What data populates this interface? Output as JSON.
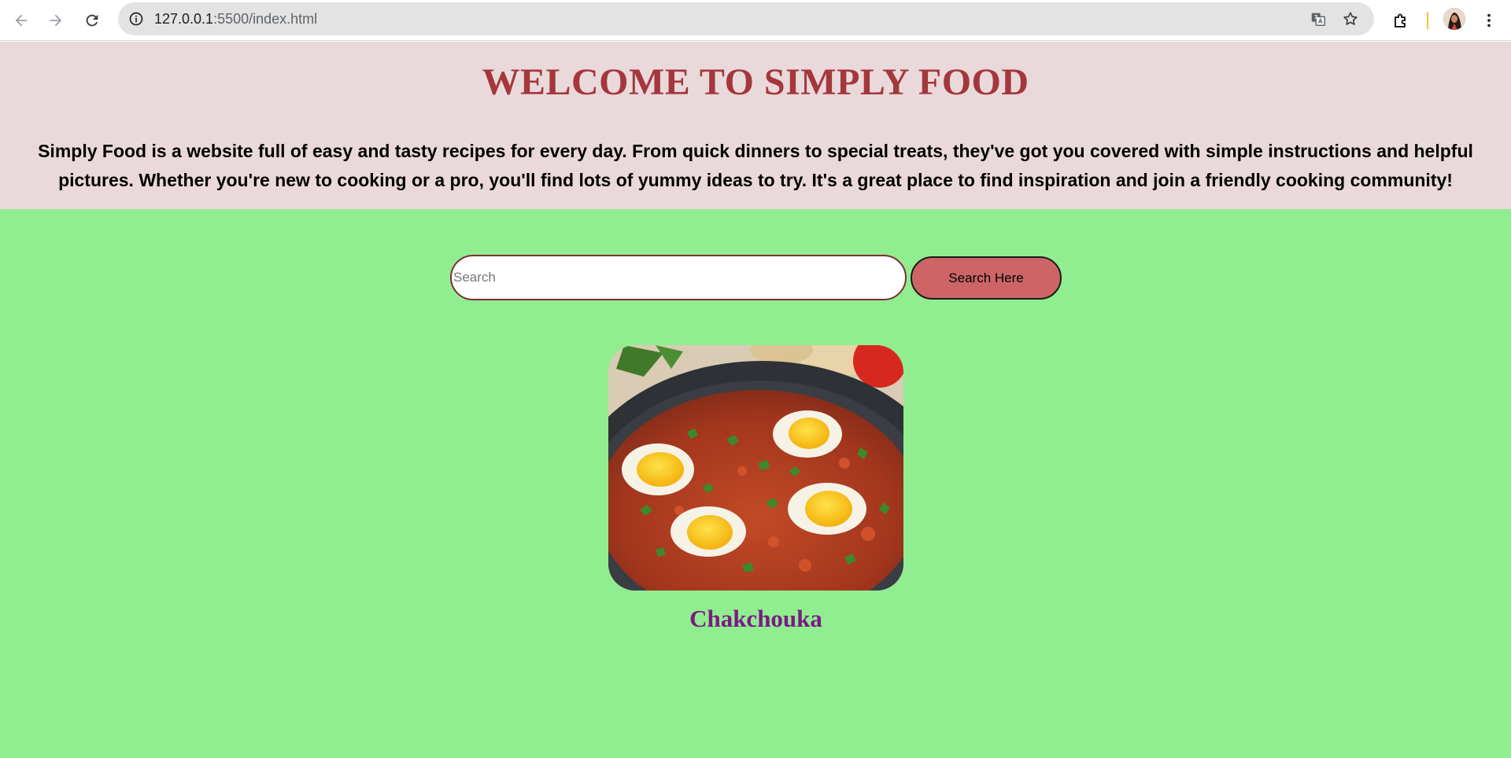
{
  "browser": {
    "url_host": "127.0.0.1",
    "url_rest": ":5500/index.html",
    "icons": {
      "back": "arrow-left-icon",
      "forward": "arrow-right-icon",
      "reload": "reload-icon",
      "site_info": "info-icon",
      "translate": "translate-icon",
      "bookmark": "star-icon",
      "extensions": "puzzle-icon",
      "menu": "kebab-menu-icon"
    }
  },
  "hero": {
    "title": "WELCOME TO SIMPLY FOOD",
    "description": "Simply Food is a website full of easy and tasty recipes for every day. From quick dinners to special treats, they've got you covered with simple instructions and helpful pictures. Whether you're new to cooking or a pro, you'll find lots of yummy ideas to try. It's a great place to find inspiration and join a friendly cooking community!"
  },
  "search": {
    "placeholder": "Search",
    "value": "",
    "button_label": "Search Here"
  },
  "recipes": [
    {
      "name": "Chakchouka",
      "image": "shakshuka-photo"
    }
  ],
  "colors": {
    "page_bg": "#90ee90",
    "hero_bg": "#ead9da",
    "title": "#a4373c",
    "button_bg": "#cd6566",
    "recipe_title": "#7b1a84"
  }
}
